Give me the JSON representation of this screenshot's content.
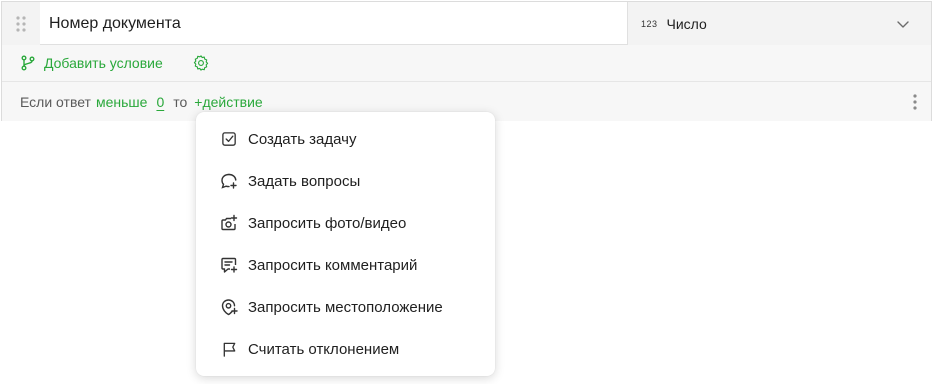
{
  "question": {
    "title": "Номер документа"
  },
  "answer_type": {
    "prefix": "123",
    "label": "Число",
    "icon": "chevron-down-icon"
  },
  "conditions": {
    "add_label": "Добавить условие",
    "settings_icon": "gear-icon"
  },
  "rule": {
    "if_text": "Если ответ",
    "operator": "меньше",
    "value": "0",
    "then_text": "то",
    "action_label": "+действие"
  },
  "colors": {
    "accent": "#2aa83b",
    "text": "#1f1f1f",
    "muted": "#5a5a5a"
  },
  "action_menu": {
    "items": [
      {
        "label": "Создать задачу",
        "icon": "task-checkbox-icon"
      },
      {
        "label": "Задать вопросы",
        "icon": "chat-plus-icon"
      },
      {
        "label": "Запросить фото/видео",
        "icon": "camera-plus-icon"
      },
      {
        "label": "Запросить комментарий",
        "icon": "comment-plus-icon"
      },
      {
        "label": "Запросить местоположение",
        "icon": "location-plus-icon"
      },
      {
        "label": "Считать отклонением",
        "icon": "flag-icon"
      }
    ]
  }
}
